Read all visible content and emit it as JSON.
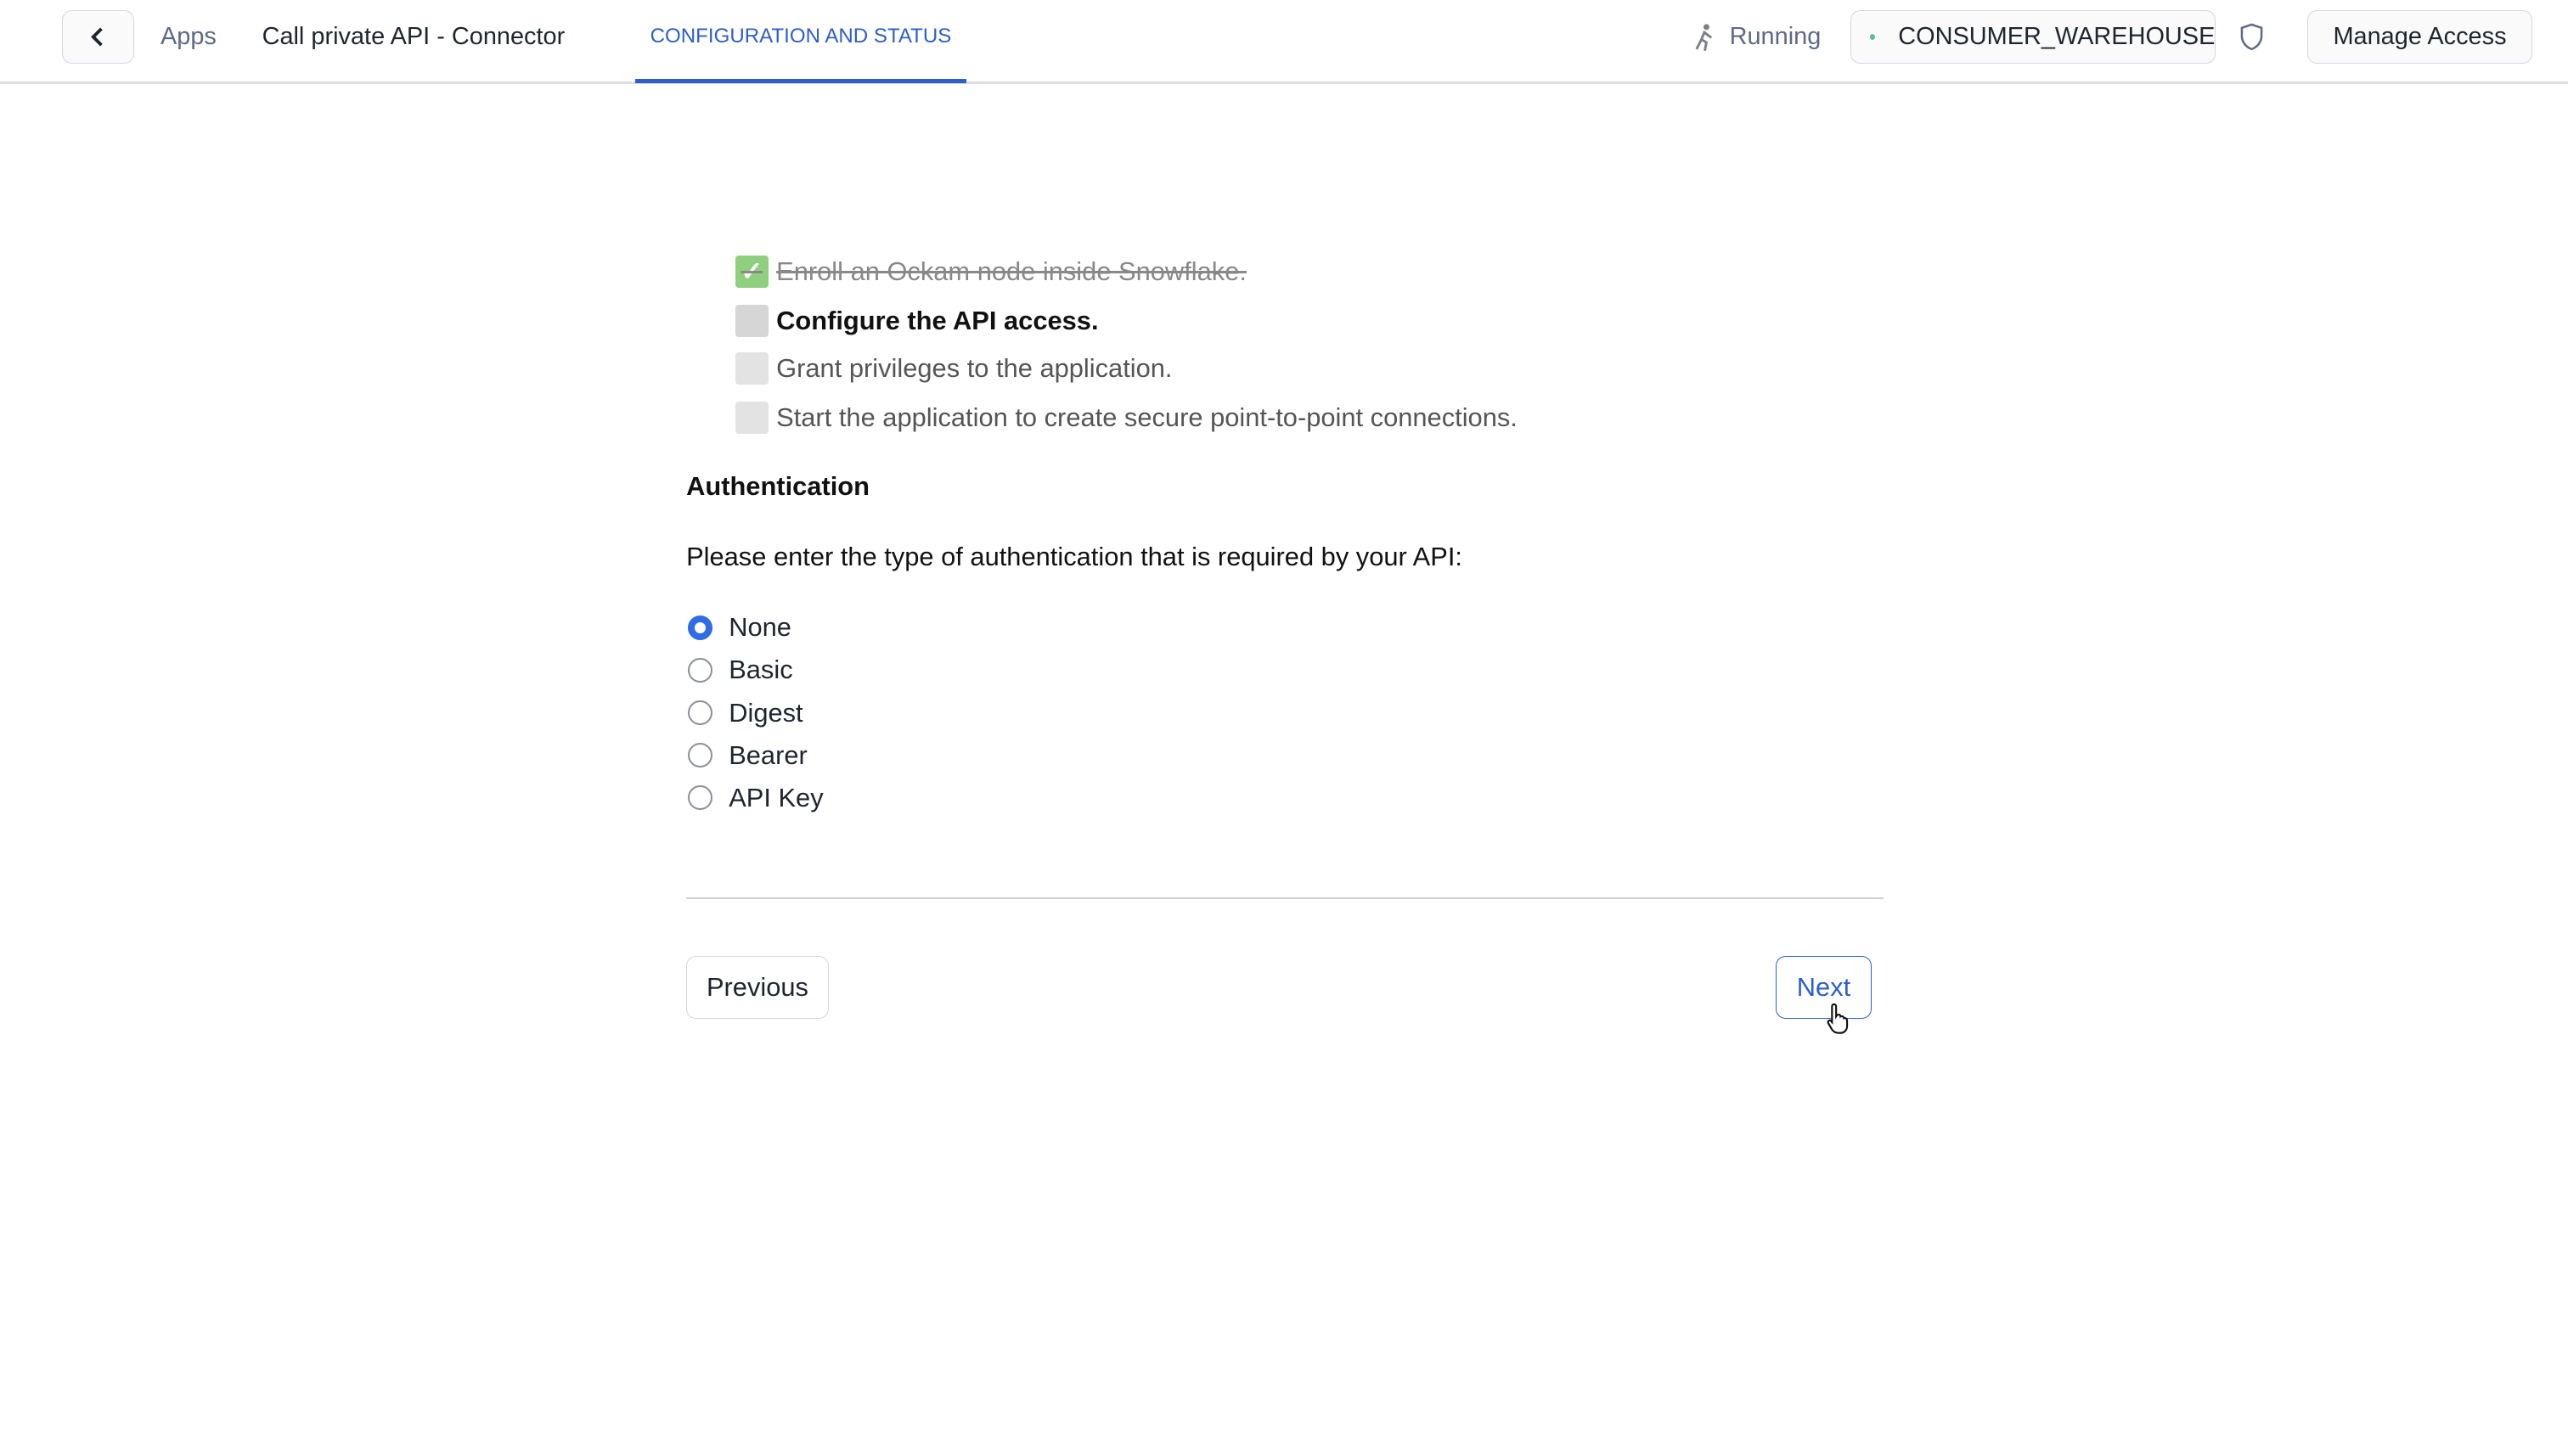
{
  "header": {
    "back_icon": "chevron-left-icon",
    "breadcrumb_apps": "Apps",
    "app_title": "Call private API - Connector",
    "tab_label": "CONFIGURATION AND STATUS",
    "status_icon": "running-person-icon",
    "status_text": "Running",
    "warehouse_status_color": "#5cc08e",
    "warehouse": "CONSUMER_WAREHOUSE",
    "shield_icon": "shield-icon",
    "manage_access": "Manage Access",
    "accent": "#2d5fc9"
  },
  "checklist": [
    {
      "label": "Enroll an Ockam node inside Snowflake.",
      "state": "done"
    },
    {
      "label": "Configure the API access.",
      "state": "current"
    },
    {
      "label": "Grant privileges to the application.",
      "state": "pending"
    },
    {
      "label": "Start the application to create secure point-to-point connections.",
      "state": "pending"
    }
  ],
  "form": {
    "section_title": "Authentication",
    "prompt": "Please enter the type of authentication that is required by your API:",
    "options": [
      "None",
      "Basic",
      "Digest",
      "Bearer",
      "API Key"
    ],
    "selected": "None"
  },
  "footer": {
    "previous": "Previous",
    "next": "Next"
  }
}
